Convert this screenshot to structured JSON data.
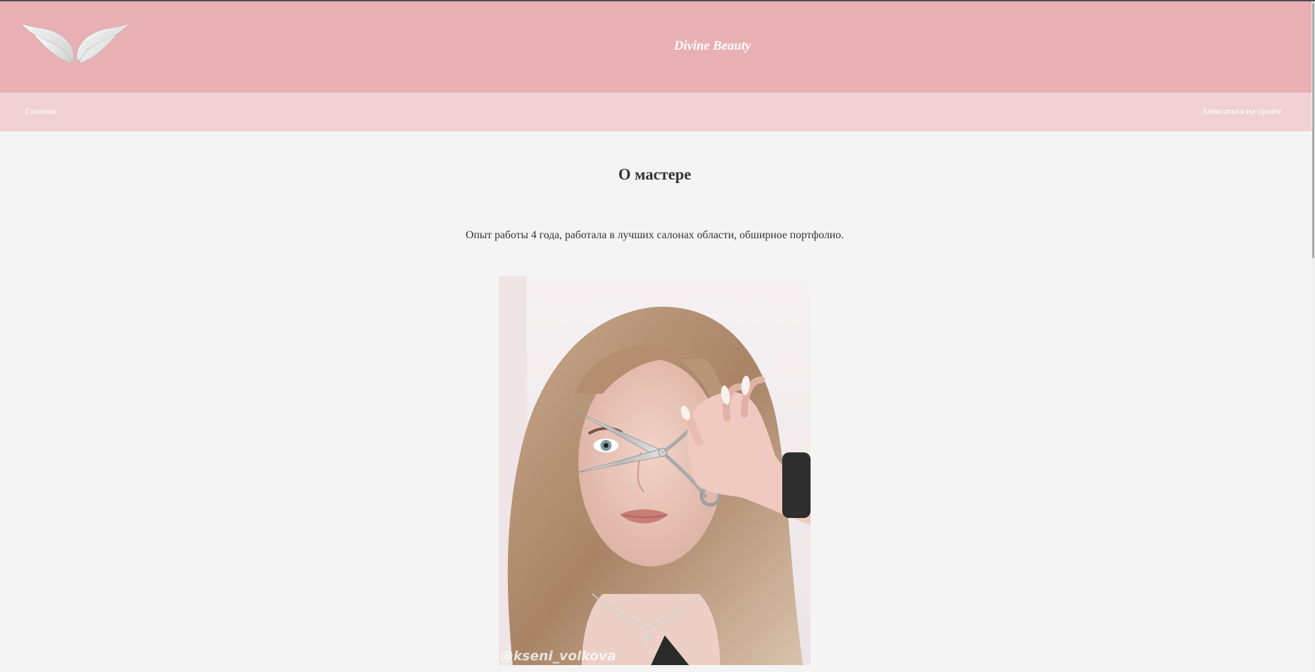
{
  "header": {
    "brand": "Divine Beauty",
    "logo_icon": "angel-wings-icon",
    "background_color": "#e8b0b3"
  },
  "nav": {
    "home_label": "Главная",
    "book_label": "Записаться на приём",
    "background_color": "#f1d1d3"
  },
  "main": {
    "title": "О мастере",
    "description": "Опыт работы 4 года, работала в лучших салонах области, обширное портфолио.",
    "photo_watermark": "@kseni_volkova"
  }
}
